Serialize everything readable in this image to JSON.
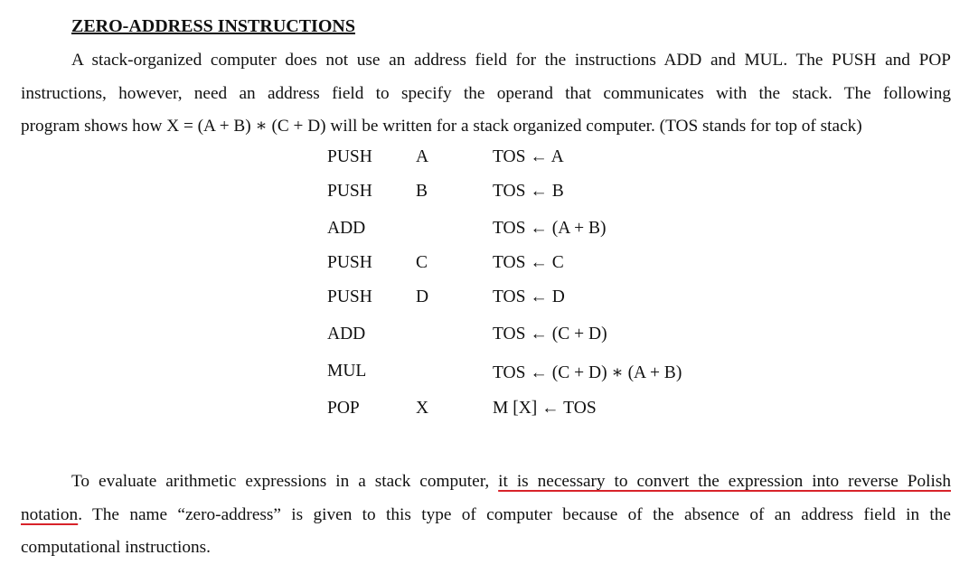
{
  "heading": "ZERO-ADDRESS INSTRUCTIONS",
  "intro": {
    "line1": "A stack-organized computer does not use an address field for the instructions ADD and MUL. The PUSH and POP",
    "line2": "instructions, however, need an address field to specify the operand that communicates with the stack. The following",
    "line3": "program shows how X = (A + B) ∗ (C + D) will be written for a stack organized computer. (TOS stands for top of stack)"
  },
  "program": [
    {
      "op": "PUSH",
      "arg": "A",
      "rtl": "TOS ← A"
    },
    {
      "op": "PUSH",
      "arg": "B",
      "rtl": "TOS ← B"
    },
    {
      "op": "ADD",
      "arg": "",
      "rtl": "TOS ← (A + B)"
    },
    {
      "op": "PUSH",
      "arg": "C",
      "rtl": "TOS ← C"
    },
    {
      "op": "PUSH",
      "arg": "D",
      "rtl": "TOS ← D"
    },
    {
      "op": "ADD",
      "arg": "",
      "rtl": "TOS ← (C + D)"
    },
    {
      "op": "MUL",
      "arg": "",
      "rtl": "TOS ← (C + D) ∗ (A + B)"
    },
    {
      "op": "POP",
      "arg": "X",
      "rtl": "M [X] ← TOS"
    }
  ],
  "outro": {
    "line1_plain": "To evaluate arithmetic expressions in a stack computer, ",
    "line1_marked": "it is necessary to convert the expression into reverse Polish",
    "line2_marked": "notation",
    "line2_plain": ". The name “zero-address” is given to this type of computer because of the absence of an address field in the",
    "line3": "computational instructions."
  },
  "colors": {
    "text": "#111111",
    "annotation_underline": "#d8232a"
  }
}
